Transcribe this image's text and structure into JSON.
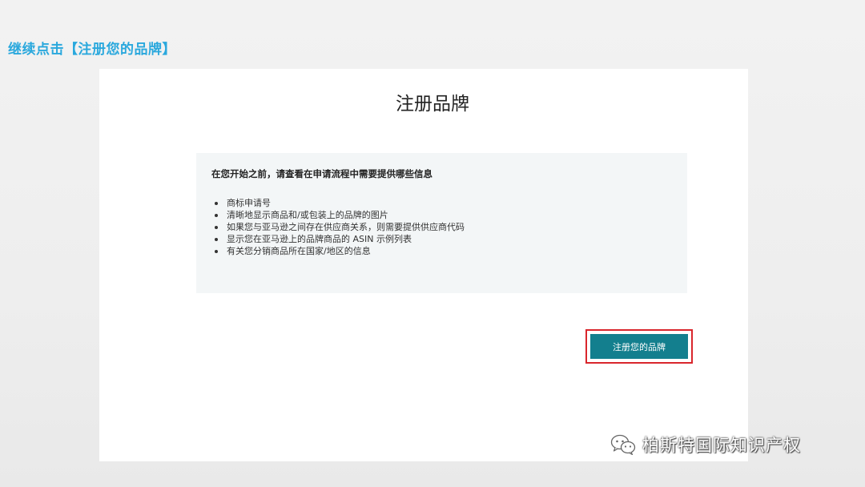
{
  "slide": {
    "heading": "继续点击【注册您的品牌】"
  },
  "page": {
    "title": "注册品牌"
  },
  "info": {
    "heading": "在您开始之前，请查看在申请流程中需要提供哪些信息",
    "items": [
      "商标申请号",
      "清晰地显示商品和/或包装上的品牌的图片",
      "如果您与亚马逊之间存在供应商关系，则需要提供供应商代码",
      "显示您在亚马逊上的品牌商品的 ASIN 示例列表",
      "有关您分销商品所在国家/地区的信息"
    ]
  },
  "cta": {
    "label": "注册您的品牌"
  },
  "watermark": {
    "text": "柏斯特国际知识产权",
    "icon": "wechat-icon"
  },
  "colors": {
    "heading": "#2aa8dd",
    "button": "#137f8e",
    "highlight": "#d9262c",
    "info_bg": "#f3f6f7"
  }
}
